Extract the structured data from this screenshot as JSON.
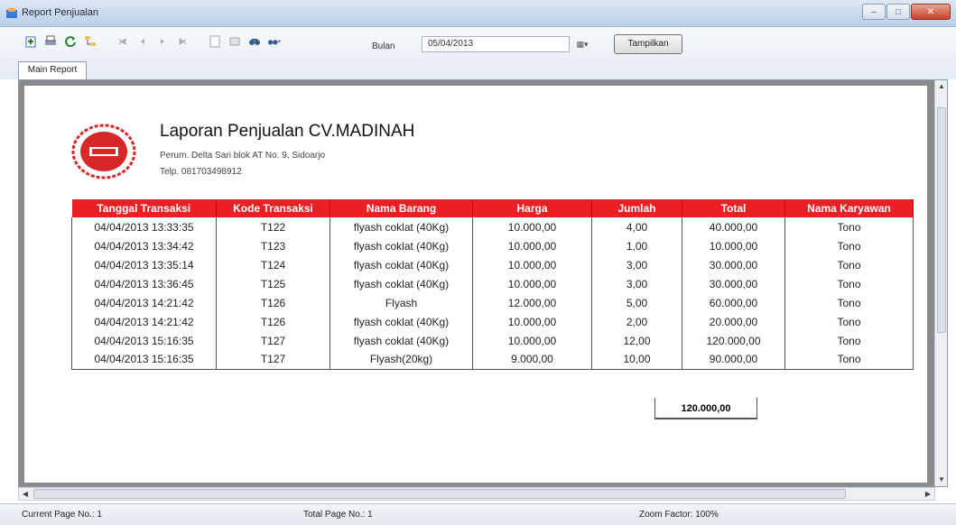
{
  "window": {
    "title": "Report Penjualan"
  },
  "toolbar": {
    "icons": [
      "export-icon",
      "print-icon",
      "refresh-icon",
      "group-tree-icon",
      "first-page-icon",
      "prev-page-icon",
      "next-page-icon",
      "last-page-icon",
      "goto-page-icon",
      "close-page-icon",
      "search-icon",
      "zoom-icon"
    ],
    "bulan_label": "Bulan",
    "date_value": "05/04/2013",
    "tampilkan_label": "Tampilkan",
    "tab_label": "Main Report"
  },
  "report": {
    "title": "Laporan Penjualan CV.MADINAH",
    "address": "Perum. Delta Sari blok AT No. 9, Sidoarjo",
    "phone": "Telp. 081703498912",
    "columns": [
      "Tanggal Transaksi",
      "Kode Transaksi",
      "Nama Barang",
      "Harga",
      "Jumlah",
      "Total",
      "Nama Karyawan"
    ],
    "rows": [
      [
        "04/04/2013  13:33:35",
        "T122",
        "flyash coklat (40Kg)",
        "10.000,00",
        "4,00",
        "40.000,00",
        "Tono"
      ],
      [
        "04/04/2013  13:34:42",
        "T123",
        "flyash coklat (40Kg)",
        "10.000,00",
        "1,00",
        "10.000,00",
        "Tono"
      ],
      [
        "04/04/2013  13:35:14",
        "T124",
        "flyash coklat (40Kg)",
        "10.000,00",
        "3,00",
        "30.000,00",
        "Tono"
      ],
      [
        "04/04/2013  13:36:45",
        "T125",
        "flyash coklat (40Kg)",
        "10.000,00",
        "3,00",
        "30.000,00",
        "Tono"
      ],
      [
        "04/04/2013  14:21:42",
        "T126",
        "Flyash",
        "12.000,00",
        "5,00",
        "60.000,00",
        "Tono"
      ],
      [
        "04/04/2013  14:21:42",
        "T126",
        "flyash coklat (40Kg)",
        "10.000,00",
        "2,00",
        "20.000,00",
        "Tono"
      ],
      [
        "04/04/2013  15:16:35",
        "T127",
        "flyash coklat (40Kg)",
        "10.000,00",
        "12,00",
        "120.000,00",
        "Tono"
      ],
      [
        "04/04/2013  15:16:35",
        "T127",
        "Flyash(20kg)",
        "9.000,00",
        "10,00",
        "90.000,00",
        "Tono"
      ]
    ],
    "grand_total": "120.000,00",
    "header_color": "#ee1f24"
  },
  "status": {
    "current_page": "Current Page No.: 1",
    "total_page": "Total Page No.: 1",
    "zoom": "Zoom Factor: 100%"
  }
}
